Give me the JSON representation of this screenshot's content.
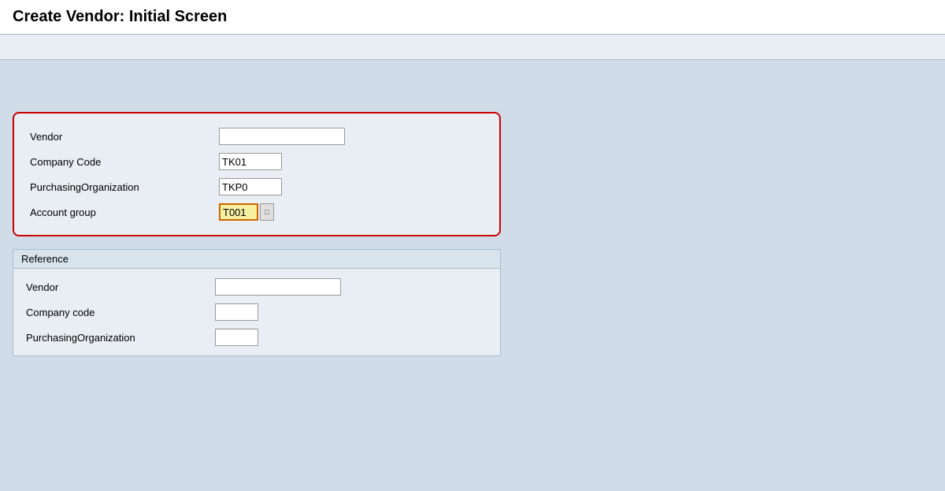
{
  "page": {
    "title": "Create Vendor:  Initial Screen"
  },
  "main_form": {
    "vendor_label": "Vendor",
    "vendor_value": "",
    "company_code_label": "Company Code",
    "company_code_value": "TK01",
    "purchasing_org_label": "PurchasingOrganization",
    "purchasing_org_value": "TKP0",
    "account_group_label": "Account group",
    "account_group_value": "T001"
  },
  "reference_section": {
    "header": "Reference",
    "vendor_label": "Vendor",
    "vendor_value": "",
    "company_code_label": "Company code",
    "company_code_value": "",
    "purchasing_org_label": "PurchasingOrganization",
    "purchasing_org_value": ""
  },
  "lookup_button_symbol": "□"
}
